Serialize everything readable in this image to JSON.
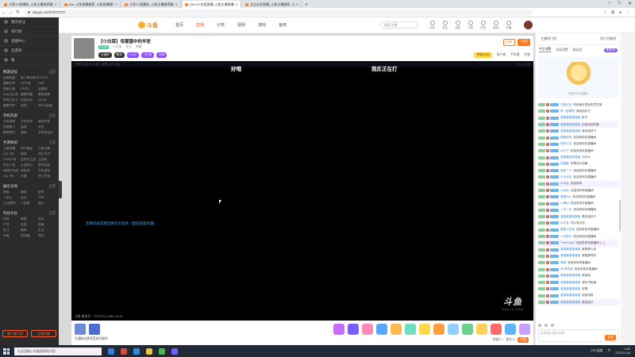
{
  "browser": {
    "tabs": [
      {
        "label": "斗鱼TV直播网_斗鱼主播推荐精彩",
        "active": false
      },
      {
        "label": "live_斗鱼直播推荐_斗鱼直播推荐",
        "active": false
      },
      {
        "label": "斗鱼TV直播网_斗鱼主播推荐精彩",
        "active": false
      },
      {
        "label": "(39+)小白菜直播_斗鱼主播直播间",
        "active": true
      },
      {
        "label": "艾吉业余直播_斗鱼主播推荐_斗...",
        "active": false
      }
    ],
    "url": "douyu.com/7072770"
  },
  "site": {
    "logo": "斗鱼",
    "nav": [
      "首页",
      "直播",
      "分类",
      "视频",
      "游戏",
      "鱼吧"
    ],
    "active_nav": "直播",
    "search_placeholder": "搜索主播",
    "icons": [
      {
        "name": "history-icon",
        "label": "历史"
      },
      {
        "name": "follow-icon",
        "label": "关注"
      },
      {
        "name": "message-icon",
        "label": "消息"
      },
      {
        "name": "upload-icon",
        "label": "下载"
      },
      {
        "name": "task-icon",
        "label": "任务"
      },
      {
        "name": "game-icon",
        "label": "游戏"
      },
      {
        "name": "open-live-icon",
        "label": "开播"
      }
    ]
  },
  "sidebar": {
    "top": [
      "我的关注",
      "排行榜",
      "直播中心",
      "云游戏",
      "看"
    ],
    "sections": [
      {
        "title": "网游竞技",
        "more": "全部",
        "items": [
          "英雄联盟",
          "地下城与勇士",
          "DOTA2",
          "魔兽世界",
          "CF手游",
          "DNF",
          "穿越火线",
          "CSGO",
          "逃跑吧",
          "lol云顶之弈",
          "魔兽争霸",
          "暴雪游戏",
          "绝地大乱斗",
          "永劫无间",
          "DOTA",
          "魔兽世界",
          "迷你",
          "APEX英雄"
        ]
      },
      {
        "title": "单机热游",
        "more": "全部",
        "items": [
          "主机游戏",
          "方舟生存",
          "我的世界",
          "怪物猎人",
          "猛男",
          "永恒",
          "绝地求生",
          "骑砍",
          "艾尔登法环"
        ]
      },
      {
        "title": "手游休闲",
        "more": "全部",
        "items": [
          "王者荣耀",
          "和平精英",
          "火影忍者",
          "QQ飞车",
          "原神",
          "明日方舟",
          "COD手游",
          "金铲铲之战",
          "三国杀",
          "第五人格",
          "天涯明月",
          "梦幻西游",
          "球球大作战",
          "阴阳师",
          "手机游戏",
          "QQ飞车",
          "光遇",
          "热门手游"
        ]
      },
      {
        "title": "娱乐天地",
        "more": "全部",
        "items": [
          "颜值",
          "舞蹈",
          "星秀",
          "二次元",
          "音乐",
          "户外",
          "互动游戏",
          "一起看",
          "娱乐"
        ]
      },
      {
        "title": "科技文化",
        "more": "全部",
        "items": [
          "科技",
          "美食",
          "交友",
          "户外",
          "社会",
          "鱼塘",
          "学习",
          "数码",
          "生活",
          "车载",
          "电竞圈",
          "知识"
        ]
      }
    ],
    "footer_buttons": [
      "客户端下载",
      "主播开播"
    ]
  },
  "room": {
    "title": "【小白菜】母猩猩中的羊驼",
    "meta": [
      "主播",
      "小白菜",
      "等级",
      "关注",
      "热度"
    ],
    "level": "Lv.43",
    "tags": [
      "大家好",
      "聊天",
      "Lv.43",
      "小白菜",
      "分享"
    ],
    "share_label": "分享",
    "follow_label": "+关注",
    "report_label": "举报/申诉",
    "right_links": [
      "客户端",
      "手机看",
      "举报"
    ]
  },
  "video": {
    "caption_left": "好哦",
    "caption_right": "我反正在打",
    "top_left": "我看你没事 Hold 就行 看看 我的 哈哈",
    "top_right": "75 : 04.005",
    "note": "无聊的就是想切换至声音表（量是很是有趣）",
    "watermark": "斗鱼",
    "watermark_sub": "DOUYU.COM",
    "footer": "斗鱼 房间号：7072770 | 2021.11.24"
  },
  "giftbar": {
    "message": "开通粉丝牌享受房间福利",
    "coin_label": "鱼翅 0 ｜ 鱼丸 0",
    "recharge_label": "充值",
    "gift_colors": [
      "#c86bff",
      "#7a5cff",
      "#ff8ab4",
      "#58a6ff",
      "#ffb84d",
      "#6de0c2",
      "#ffd84a",
      "#ff9e3d",
      "#8fd0ff",
      "#6bd18d",
      "#ffcf5a",
      "#ff6a6a",
      "#5fb4ff",
      "#c9a0ff"
    ]
  },
  "chat": {
    "header": [
      "主播热门榜",
      "用户贡献榜"
    ],
    "tabs": [
      "今日消费",
      "本周消费",
      "粉丝团"
    ],
    "fans_label": "粉丝团",
    "rank_placeholder": "快来守护主播吧",
    "messages": [
      {
        "user": "艾希头目",
        "text": "你说我去里我本意打架"
      },
      {
        "user": "修一起看吧",
        "text": "我说话好卡"
      },
      {
        "user": "落落落落落落落",
        "text": "好卡"
      },
      {
        "user": "落落落落落落落",
        "text": "白色比较好看"
      },
      {
        "user": "落落落落落落落",
        "text": "我说话好卡"
      },
      {
        "user": "超级球球",
        "text": "欢迎来到本直播间"
      },
      {
        "user": "快乐小白",
        "text": "欢迎来到本直播间"
      },
      {
        "user": "lol小子",
        "text": "欢迎来到本直播间"
      },
      {
        "user": "落落落落落落落",
        "text": "为什么"
      },
      {
        "user": "的星星",
        "text": "你是怎么回事"
      },
      {
        "user": "哈哈一下",
        "text": "欢迎来到本直播间"
      },
      {
        "user": "小小分析",
        "text": "欢迎来到本直播间"
      },
      {
        "user": "lol不会",
        "text": "欢迎来到"
      },
      {
        "user": "小Qian",
        "text": "欢迎来到本直播间"
      },
      {
        "user": "落落Kez",
        "text": "欢迎来到本直播间"
      },
      {
        "user": "小琳lol",
        "text": "欢迎来到本直播间"
      },
      {
        "user": "一天一天",
        "text": "欢迎来到本直播间"
      },
      {
        "user": "落落落落落落落",
        "text": "是说话好卡"
      },
      {
        "user": "lol不会",
        "text": "可以有办法"
      },
      {
        "user": "星星小白菜",
        "text": "欢迎来到本直播间"
      },
      {
        "user": "小白菜lol",
        "text": "欢迎来到本直播间"
      },
      {
        "user": "TrollerLight",
        "text": "欢迎来到本直播间 (-_-)"
      },
      {
        "user": "落落落落落落落",
        "text": "就是那么多"
      },
      {
        "user": "落落落落落落落",
        "text": "我是那样的"
      },
      {
        "user": "落落",
        "text": "欢迎来到本直播间"
      },
      {
        "user": "Mr.青花瓷",
        "text": "欢迎来到本直播间"
      },
      {
        "user": "落落落落落落落",
        "text": "哈哈哈"
      },
      {
        "user": "落落落落落落落",
        "text": "我也不知道"
      },
      {
        "user": "落落落落落落落",
        "text": "好啊"
      },
      {
        "user": "落落落落落落落",
        "text": "哈哈哈哈"
      },
      {
        "user": "落落落落落落落",
        "text": "我说话卡"
      }
    ],
    "input_placeholder": "这里输入聊天内容",
    "send_label": "发送"
  },
  "taskbar": {
    "search_placeholder": "在这里输入你要搜索的内容",
    "tray": [
      "中",
      "CPU温度"
    ],
    "time": "0:50",
    "date": "2021/11/24"
  }
}
